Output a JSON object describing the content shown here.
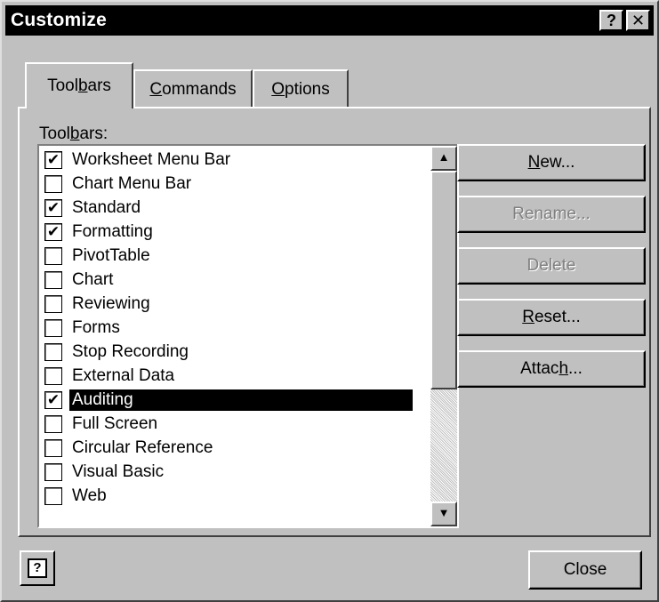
{
  "window": {
    "title": "Customize",
    "help_glyph": "?",
    "close_glyph": "✕"
  },
  "tabs": [
    {
      "pre": "Tool",
      "accel": "b",
      "post": "ars",
      "active": true
    },
    {
      "pre": "",
      "accel": "C",
      "post": "ommands",
      "active": false
    },
    {
      "pre": "",
      "accel": "O",
      "post": "ptions",
      "active": false
    }
  ],
  "list_label": {
    "pre": "Tool",
    "accel": "b",
    "post": "ars:"
  },
  "toolbars": [
    {
      "label": "Worksheet Menu Bar",
      "checked": true
    },
    {
      "label": "Chart Menu Bar",
      "checked": false
    },
    {
      "label": "Standard",
      "checked": true
    },
    {
      "label": "Formatting",
      "checked": true
    },
    {
      "label": "PivotTable",
      "checked": false
    },
    {
      "label": "Chart",
      "checked": false
    },
    {
      "label": "Reviewing",
      "checked": false
    },
    {
      "label": "Forms",
      "checked": false
    },
    {
      "label": "Stop Recording",
      "checked": false
    },
    {
      "label": "External Data",
      "checked": false
    },
    {
      "label": "Auditing",
      "checked": true,
      "selected": true
    },
    {
      "label": "Full Screen",
      "checked": false
    },
    {
      "label": "Circular Reference",
      "checked": false
    },
    {
      "label": "Visual Basic",
      "checked": false
    },
    {
      "label": "Web",
      "checked": false
    }
  ],
  "scrollbar": {
    "up_glyph": "▲",
    "down_glyph": "▼"
  },
  "buttons": {
    "new": {
      "pre": "",
      "accel": "N",
      "post": "ew..."
    },
    "rename": {
      "label": "Rename..."
    },
    "delete": {
      "label": "Delete"
    },
    "reset": {
      "pre": "",
      "accel": "R",
      "post": "eset..."
    },
    "attach": {
      "pre": "Attac",
      "accel": "h",
      "post": "..."
    },
    "close": {
      "label": "Close"
    },
    "help_glyph": "?"
  },
  "check_glyph": "✔"
}
